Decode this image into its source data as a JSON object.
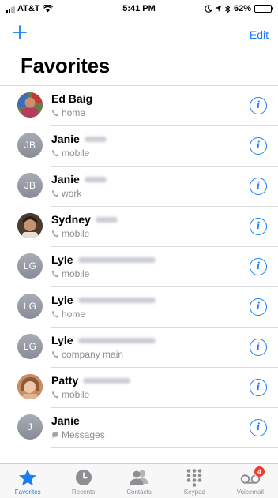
{
  "status_bar": {
    "carrier": "AT&T",
    "time": "5:41 PM",
    "battery": "62%",
    "battery_level": 0.62
  },
  "nav": {
    "edit_label": "Edit"
  },
  "title": "Favorites",
  "favorites": [
    {
      "name": "Ed Baig",
      "label": "home",
      "initials": "",
      "photo": "photo-ed",
      "type": "phone"
    },
    {
      "name": "Janie",
      "label": "mobile",
      "initials": "JB",
      "photo": "",
      "type": "phone"
    },
    {
      "name": "Janie",
      "label": "work",
      "initials": "JB",
      "photo": "",
      "type": "phone"
    },
    {
      "name": "Sydney",
      "label": "mobile",
      "initials": "",
      "photo": "photo-sydney",
      "type": "phone"
    },
    {
      "name": "Lyle",
      "label": "mobile",
      "initials": "LG",
      "photo": "",
      "type": "phone"
    },
    {
      "name": "Lyle",
      "label": "home",
      "initials": "LG",
      "photo": "",
      "type": "phone"
    },
    {
      "name": "Lyle",
      "label": "company main",
      "initials": "LG",
      "photo": "",
      "type": "phone"
    },
    {
      "name": "Patty",
      "label": "mobile",
      "initials": "",
      "photo": "photo-patty",
      "type": "phone"
    },
    {
      "name": "Janie",
      "label": "Messages",
      "initials": "J",
      "photo": "",
      "type": "message"
    }
  ],
  "tabs": [
    {
      "label": "Favorites",
      "icon": "star-icon",
      "active": true
    },
    {
      "label": "Recents",
      "icon": "clock-icon",
      "active": false
    },
    {
      "label": "Contacts",
      "icon": "contacts-icon",
      "active": false
    },
    {
      "label": "Keypad",
      "icon": "keypad-icon",
      "active": false
    },
    {
      "label": "Voicemail",
      "icon": "voicemail-icon",
      "active": false,
      "badge": "4"
    }
  ],
  "colors": {
    "accent": "#1a7df3",
    "badge": "#f23a30",
    "secondary_text": "#8d8d93"
  }
}
